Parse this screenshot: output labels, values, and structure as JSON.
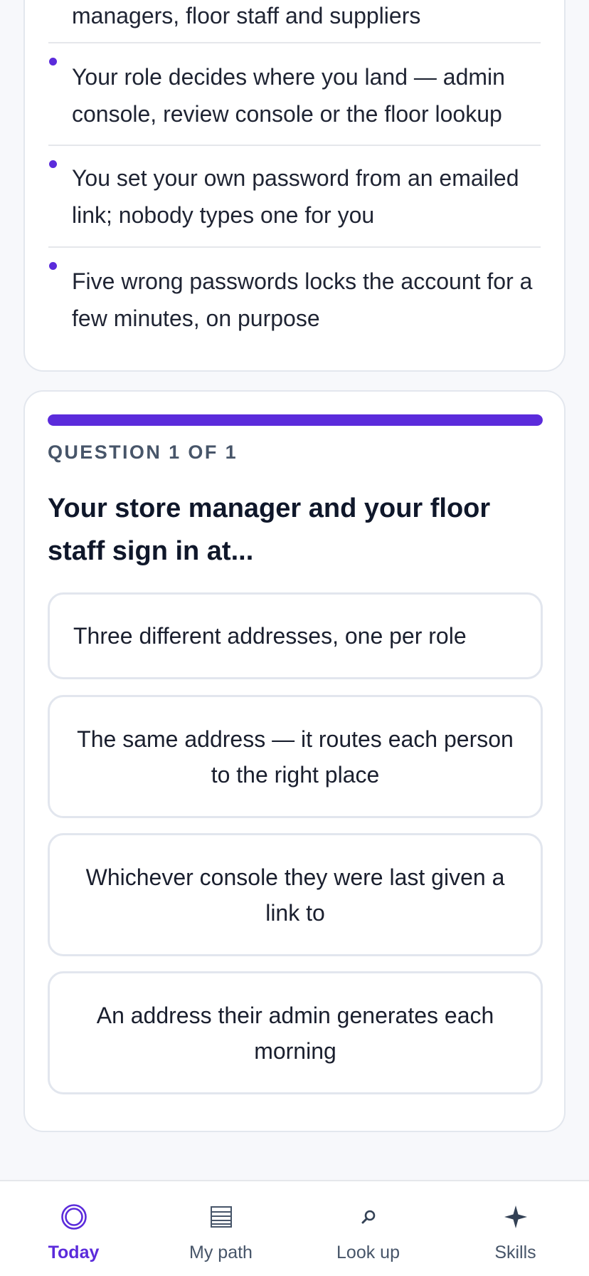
{
  "summary": {
    "items": [
      {
        "text": "managers, floor staff and suppliers"
      },
      {
        "text": "Your role decides where you land — admin console, review console or the floor lookup"
      },
      {
        "text": "You set your own password from an emailed link; nobody types one for you"
      },
      {
        "text": "Five wrong passwords locks the account for a few minutes, on purpose"
      }
    ]
  },
  "quiz": {
    "progress": 1.0,
    "counter": "QUESTION 1 OF 1",
    "question": "Your store manager and your floor staff sign in at...",
    "options": [
      {
        "label": "Three different addresses, one per role"
      },
      {
        "label": "The same address — it routes each person to the right place"
      },
      {
        "label": "Whichever console they were last given a link to"
      },
      {
        "label": "An address their admin generates each morning"
      }
    ]
  },
  "nav": {
    "active": "today",
    "items": [
      {
        "id": "today",
        "label": "Today",
        "icon": "target-icon"
      },
      {
        "id": "my-path",
        "label": "My path",
        "icon": "list-icon"
      },
      {
        "id": "look-up",
        "label": "Look up",
        "icon": "search-icon"
      },
      {
        "id": "skills",
        "label": "Skills",
        "icon": "sparkle-icon"
      }
    ]
  },
  "colors": {
    "accent": "#5b2bdb",
    "text": "#111827",
    "muted": "#475569",
    "border": "#e2e6ee",
    "background": "#f7f8fb"
  }
}
